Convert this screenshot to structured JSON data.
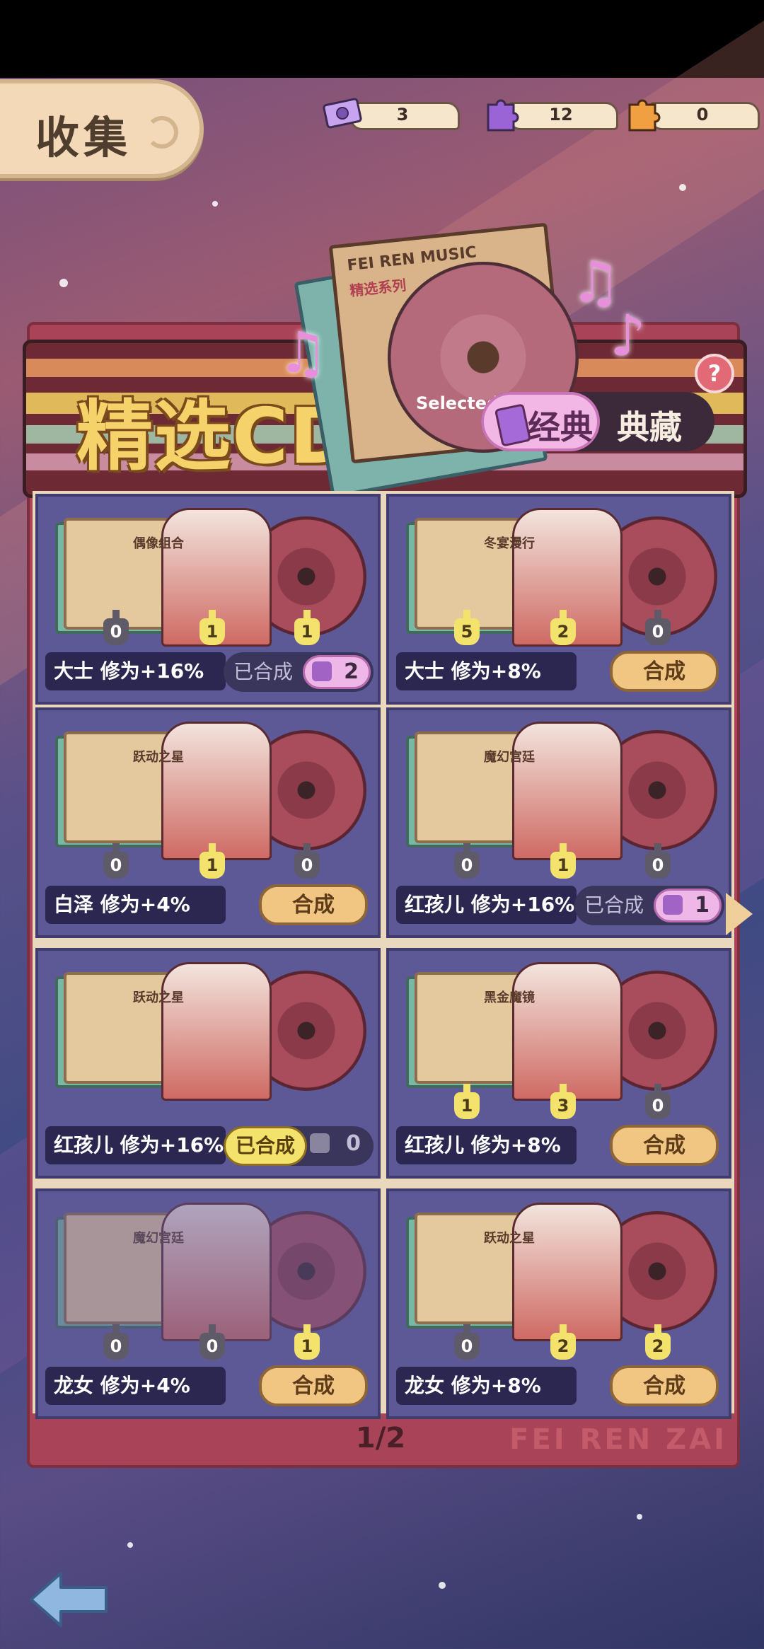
{
  "header": {
    "title": "收集",
    "resources": [
      {
        "name": "ticket",
        "value": "3",
        "color": "#b48be8"
      },
      {
        "name": "puzzle-purple",
        "value": "12",
        "color": "#8a58c8"
      },
      {
        "name": "puzzle-orange",
        "value": "0",
        "color": "#e99a3c"
      }
    ]
  },
  "banner": {
    "title": "精选CD",
    "cd_logo": "FEI REN MUSIC",
    "cd_sub": "精选系列",
    "cd_caption": "Selected",
    "toggle_on": "经典",
    "toggle_off": "典藏",
    "help": "?"
  },
  "cards": [
    {
      "title": "偶像组合",
      "pins": [
        "0",
        "1",
        "1"
      ],
      "pins_lit": [
        false,
        true,
        true
      ],
      "desc": "大士  修为+16%",
      "state": "done",
      "done_label": "已合成",
      "puzzle_count": "2"
    },
    {
      "title": "冬宴漫行",
      "pins": [
        "5",
        "2",
        "0"
      ],
      "pins_lit": [
        true,
        true,
        false
      ],
      "desc": "大士  修为+8%",
      "state": "button",
      "button": "合成"
    },
    {
      "title": "跃动之星",
      "pins": [
        "0",
        "1",
        "0"
      ],
      "pins_lit": [
        false,
        true,
        false
      ],
      "desc": "白泽  修为+4%",
      "state": "button",
      "button": "合成"
    },
    {
      "title": "魔幻宫廷",
      "pins": [
        "0",
        "1",
        "0"
      ],
      "pins_lit": [
        false,
        true,
        false
      ],
      "desc": "红孩儿 修为+16%",
      "state": "done",
      "done_label": "已合成",
      "puzzle_count": "1"
    },
    {
      "title": "跃动之星",
      "pins": [],
      "pins_lit": [],
      "desc": "红孩儿 修为+16%",
      "state": "done-lit",
      "done_label": "已合成",
      "puzzle_count": "0"
    },
    {
      "title": "黑金魔镜",
      "pins": [
        "1",
        "3",
        "0"
      ],
      "pins_lit": [
        true,
        true,
        false
      ],
      "desc": "红孩儿 修为+8%",
      "state": "button",
      "button": "合成"
    },
    {
      "title": "魔幻宫廷",
      "pins": [
        "0",
        "0",
        "1"
      ],
      "pins_lit": [
        false,
        false,
        true
      ],
      "desc": "龙女  修为+4%",
      "state": "button",
      "button": "合成"
    },
    {
      "title": "跃动之星",
      "pins": [
        "0",
        "2",
        "2"
      ],
      "pins_lit": [
        false,
        true,
        true
      ],
      "desc": "龙女  修为+8%",
      "state": "button",
      "button": "合成"
    }
  ],
  "pager": {
    "label": "1/2",
    "watermark": "FEI REN ZAI"
  },
  "nav": {
    "back_icon": "back-arrow-icon",
    "next_icon": "next-page-arrow-icon"
  }
}
